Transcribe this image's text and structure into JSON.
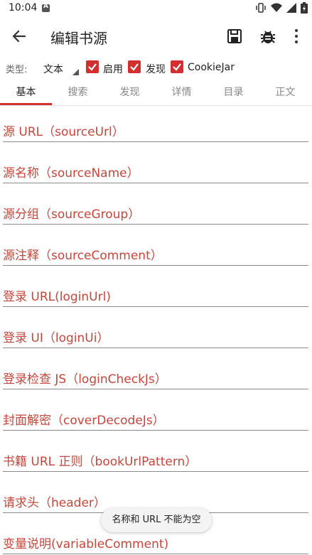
{
  "status_bar": {
    "time": "10:04",
    "icons": [
      "a-notification-icon",
      "vibrate-icon",
      "wifi-icon",
      "signal-icon",
      "battery-icon"
    ]
  },
  "app_bar": {
    "title": "编辑书源",
    "back_icon": "arrow-back-icon",
    "save_icon": "save-icon",
    "debug_icon": "bug-icon",
    "more_icon": "more-vert-icon"
  },
  "type_row": {
    "label": "类型:",
    "selected_type": "文本",
    "checkboxes": [
      {
        "label": "启用",
        "checked": true
      },
      {
        "label": "发现",
        "checked": true
      },
      {
        "label": "CookieJar",
        "checked": true
      }
    ]
  },
  "tabs": [
    "基本",
    "搜索",
    "发现",
    "详情",
    "目录",
    "正文"
  ],
  "active_tab": "基本",
  "fields": [
    "源 URL（sourceUrl）",
    "源名称（sourceName）",
    "源分组（sourceGroup）",
    "源注释（sourceComment）",
    "登录 URL(loginUrl)",
    "登录 UI（loginUi）",
    "登录检查 JS（loginCheckJs）",
    "封面解密（coverDecodeJs）",
    "书籍 URL 正则（bookUrlPattern）",
    "请求头（header）",
    "变量说明(variableComment)"
  ],
  "toast": "名称和 URL 不能为空",
  "colors": {
    "accent": "#d32f2f",
    "hint_text": "#c9453a",
    "text": "#222222"
  }
}
